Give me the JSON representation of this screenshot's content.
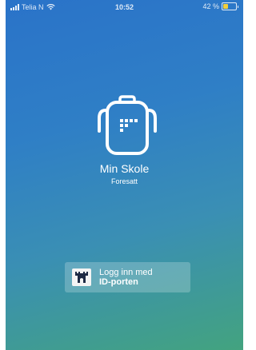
{
  "status_bar": {
    "carrier": "Telia N",
    "time": "10:52",
    "battery_text": "42 %",
    "battery_level": 0.42,
    "battery_color": "#f3cf3b",
    "signal_icon": "signal-bars-icon",
    "wifi_icon": "wifi-icon"
  },
  "app": {
    "name": "Min Skole",
    "subtitle": "Foresatt",
    "logo_icon": "backpack-icon"
  },
  "login": {
    "line1": "Logg inn med",
    "line2": "ID-porten",
    "icon": "id-porten-icon"
  },
  "colors": {
    "gradient_top": "#2a73c9",
    "gradient_bottom": "#43a37f"
  }
}
